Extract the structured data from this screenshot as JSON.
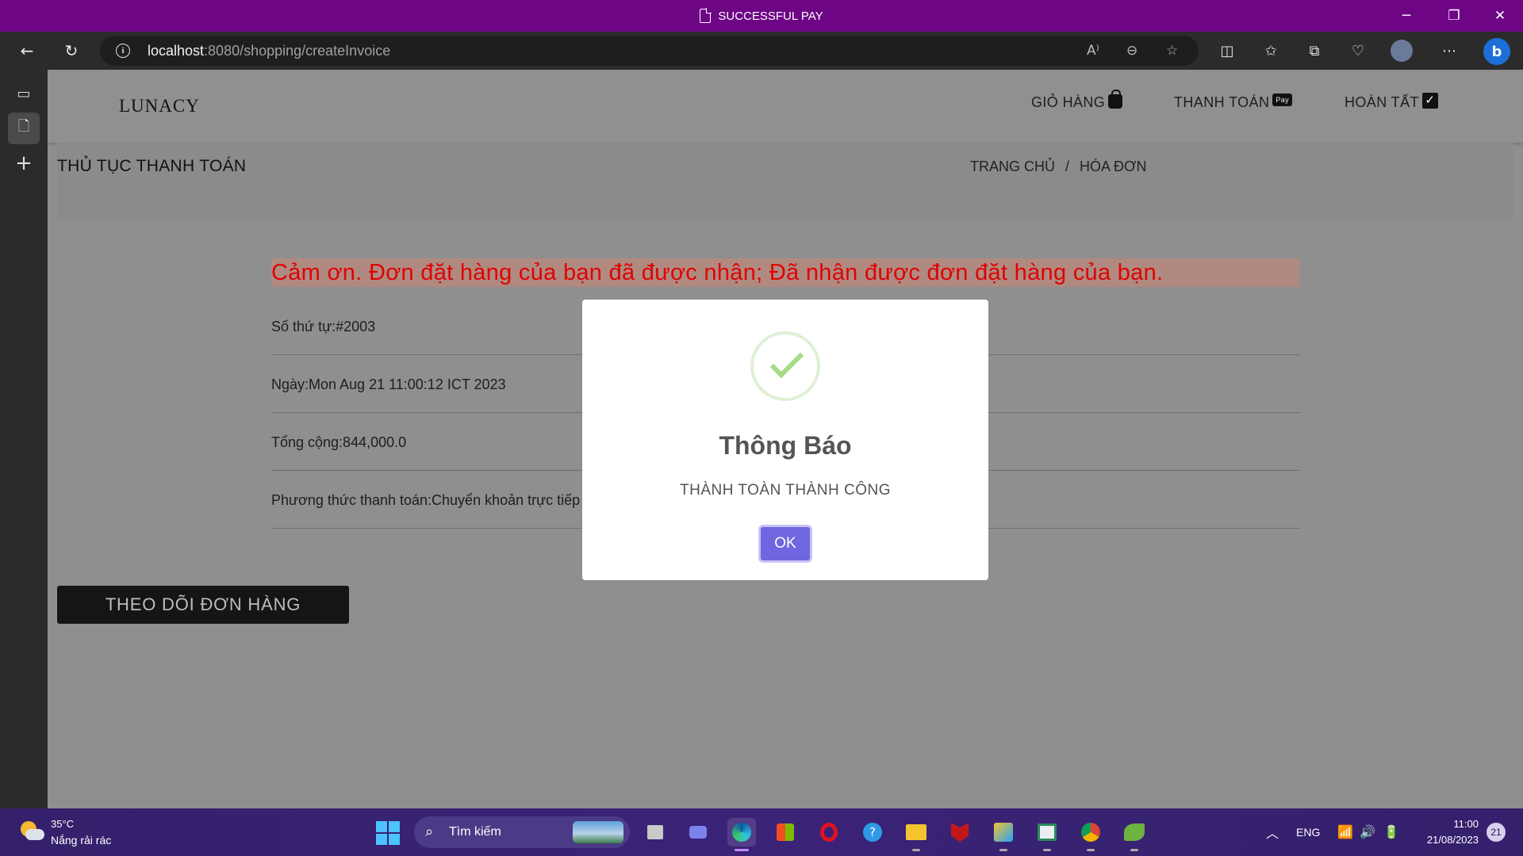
{
  "window": {
    "title": "SUCCESSFUL PAY",
    "minimize": "─",
    "restore": "❐",
    "close": "✕"
  },
  "browser": {
    "url_host": "localhost",
    "url_path": ":8080/shopping/createInvoice"
  },
  "site": {
    "logo": "LUNACY",
    "nav": {
      "cart": "GIỎ HÀNG",
      "checkout": "THANH TOÁN",
      "pay_badge": "Pay",
      "done": "HOÀN TẤT"
    },
    "page_title": "THỦ TỤC THANH TOÁN",
    "breadcrumb": {
      "home": "TRANG CHỦ",
      "separator": "/",
      "current": "HÓA ĐƠN"
    }
  },
  "invoice": {
    "thanks_message": "Cảm ơn. Đơn đặt hàng của bạn đã được nhận; Đã nhận được đơn đặt hàng của bạn.",
    "order_number": "Số thứ tự:#2003",
    "date": "Ngày:Mon Aug 21 11:00:12 ICT 2023",
    "total": "Tổng cộng:844,000.0",
    "payment_method": "Phương thức thanh toán:Chuyển khoản trực tiếp"
  },
  "track_button": "THEO DÕI ĐƠN HÀNG",
  "modal": {
    "title": "Thông Báo",
    "message": "THÀNH TOÀN THÀNH CÔNG",
    "ok": "OK",
    "icon": "success-check-icon",
    "icon_color": "#a5dc86",
    "button_color": "#7066e0"
  },
  "taskbar": {
    "temperature": "35°C",
    "weather": "Nắng rải rác",
    "search_label": "Tìm kiếm",
    "language": "ENG",
    "time": "11:00",
    "date": "21/08/2023",
    "notifications": "21"
  },
  "colors": {
    "titlebar": "#6d0585",
    "thanks_text": "#e00000",
    "thanks_bg": "#b08a80"
  }
}
